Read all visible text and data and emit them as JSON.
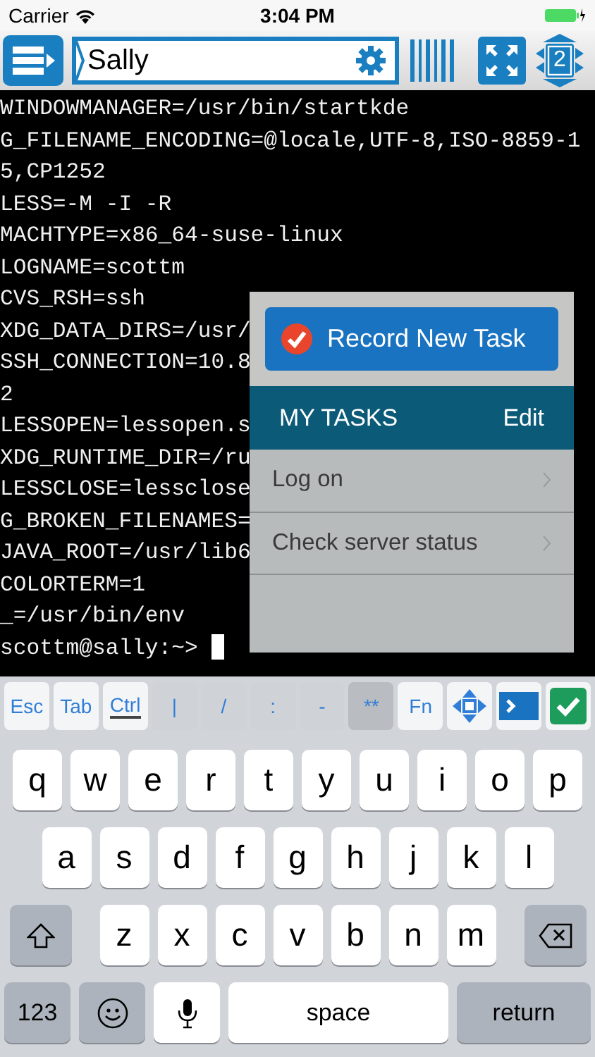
{
  "status_bar": {
    "carrier": "Carrier",
    "time": "3:04 PM"
  },
  "toolbar": {
    "host_field": {
      "value": "Sally"
    },
    "session_count": "2"
  },
  "terminal": {
    "lines": [
      "WINDOWMANAGER=/usr/bin/startkde",
      "G_FILENAME_ENCODING=@locale,UTF-8,ISO-8859-1",
      "5,CP1252",
      "LESS=-M -I -R",
      "MACHTYPE=x86_64-suse-linux",
      "LOGNAME=scottm",
      "CVS_RSH=ssh",
      "XDG_DATA_DIRS=/usr/",
      "SSH_CONNECTION=10.8",
      "2",
      "LESSOPEN=lessopen.s",
      "XDG_RUNTIME_DIR=/ru",
      "LESSCLOSE=lessclose",
      "G_BROKEN_FILENAMES=",
      "JAVA_ROOT=/usr/lib6",
      "COLORTERM=1",
      "_=/usr/bin/env",
      "scottm@sally:~> "
    ]
  },
  "tasks_popup": {
    "record_button": "Record New Task",
    "header": "MY TASKS",
    "edit": "Edit",
    "tasks": [
      "Log on",
      "Check server status"
    ]
  },
  "accessory_keys": [
    {
      "label": "Esc",
      "kind": "modifier",
      "on": false
    },
    {
      "label": "Tab",
      "kind": "modifier",
      "on": false
    },
    {
      "label": "Ctrl",
      "kind": "modifier",
      "on": true
    },
    {
      "label": "|",
      "kind": "symbol",
      "on": false
    },
    {
      "label": "/",
      "kind": "symbol",
      "on": false
    },
    {
      "label": ":",
      "kind": "symbol",
      "on": false
    },
    {
      "label": "-",
      "kind": "symbol",
      "on": false
    },
    {
      "label": "**",
      "kind": "symbol",
      "on": true
    },
    {
      "label": "Fn",
      "kind": "modifier",
      "on": false
    }
  ],
  "keyboard": {
    "rows": [
      [
        "q",
        "w",
        "e",
        "r",
        "t",
        "y",
        "u",
        "i",
        "o",
        "p"
      ],
      [
        "a",
        "s",
        "d",
        "f",
        "g",
        "h",
        "j",
        "k",
        "l"
      ],
      [
        "z",
        "x",
        "c",
        "v",
        "b",
        "n",
        "m"
      ]
    ],
    "numbers_key": "123",
    "space_key": "space",
    "return_key": "return"
  }
}
